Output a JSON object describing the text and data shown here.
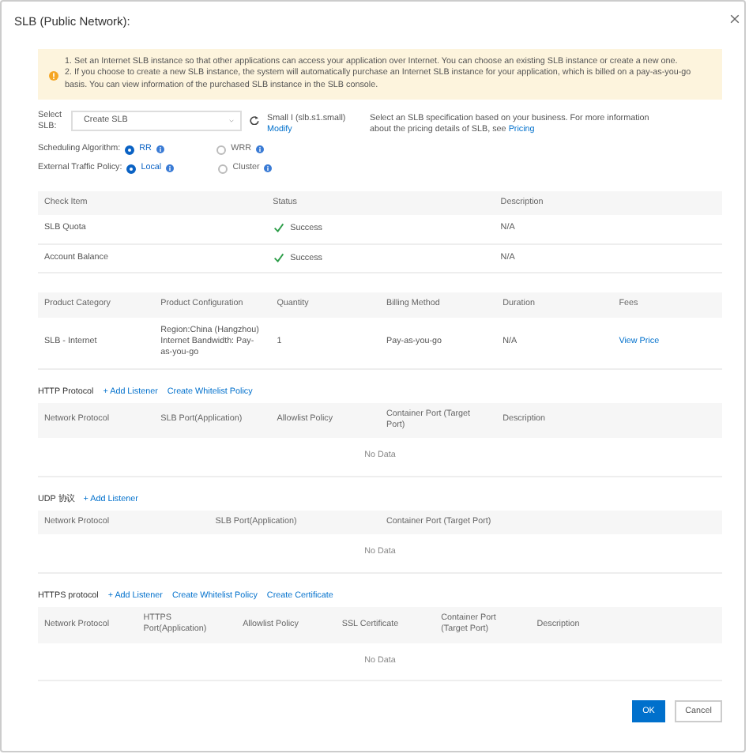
{
  "title": "SLB (Public Network):",
  "alert": [
    "1. Set an Internet SLB instance so that other applications can access your application over Internet. You can choose an existing SLB instance or create a new one.",
    "2. If you choose to create a new SLB instance, the system will automatically purchase an Internet SLB instance for your application, which is billed on a pay-as-you-go basis. You can view information of the purchased SLB instance in the SLB console."
  ],
  "select": {
    "label": "Select SLB:",
    "value": "Create SLB",
    "spec": "Small I (slb.s1.small)",
    "spec_link": "Modify",
    "hint": "Select an SLB specification based on your business. For more information about the pricing details of SLB, see",
    "hint_link": "Pricing"
  },
  "radio_groups": [
    {
      "label": "Scheduling Algorithm:",
      "options": [
        {
          "label": "RR",
          "selected": true
        },
        {
          "label": "WRR",
          "selected": false
        }
      ]
    },
    {
      "label": "External Traffic Policy:",
      "options": [
        {
          "label": "Local",
          "selected": true
        },
        {
          "label": "Cluster",
          "selected": false
        }
      ]
    }
  ],
  "check_table": {
    "columns": [
      "Check Item",
      "Status",
      "Description"
    ],
    "rows": [
      {
        "item": "SLB Quota",
        "status": "Success",
        "kind": "success",
        "description": "N/A"
      },
      {
        "item": "Account Balance",
        "status": "Success",
        "kind": "success",
        "description": "N/A"
      }
    ]
  },
  "product_table": {
    "columns": [
      "Product Category",
      "Product Configuration",
      "Quantity",
      "Billing Method",
      "Duration",
      "Fees"
    ],
    "rows": [
      {
        "category": "SLB - Internet",
        "configuration": "Region:China (Hangzhou) Internet Bandwidth: Pay-as-you-go",
        "quantity": "1",
        "billing": "Pay-as-you-go",
        "duration": "N/A",
        "fees": "View Price"
      }
    ]
  },
  "listeners": [
    {
      "title": "HTTP Protocol",
      "actions": [
        "+ Add Listener",
        "Create Whitelist Policy"
      ],
      "columns": [
        "Network Protocol",
        "SLB Port(Application)",
        "Allowlist Policy",
        "Container Port (Target Port)",
        "Description"
      ],
      "empty": "No Data"
    },
    {
      "title": "UDP 协议",
      "actions": [
        "+ Add Listener"
      ],
      "columns": [
        "Network Protocol",
        "SLB Port(Application)",
        "Container Port (Target Port)"
      ],
      "empty": "No Data"
    },
    {
      "title": "HTTPS protocol",
      "actions": [
        "+ Add Listener",
        "Create Whitelist Policy",
        "Create Certificate"
      ],
      "columns": [
        "Network Protocol",
        "HTTPS Port(Application)",
        "Allowlist Policy",
        "SSL Certificate",
        "Container Port (Target Port)",
        "Description"
      ],
      "empty": "No Data"
    }
  ],
  "buttons": [
    {
      "label": "OK",
      "kind": "primary"
    },
    {
      "label": "Cancel",
      "kind": "secondary"
    }
  ]
}
